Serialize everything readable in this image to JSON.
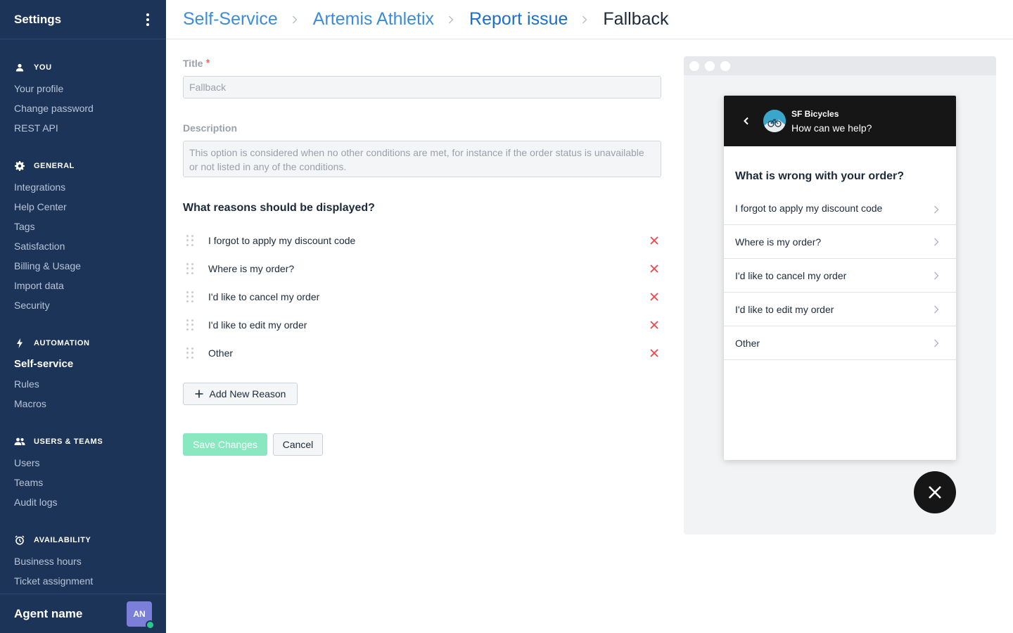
{
  "sidebar": {
    "title": "Settings",
    "sections": [
      {
        "key": "you",
        "label": "YOU",
        "icon": "user-icon",
        "items": [
          {
            "label": "Your profile"
          },
          {
            "label": "Change password"
          },
          {
            "label": "REST API"
          }
        ]
      },
      {
        "key": "general",
        "label": "GENERAL",
        "icon": "gear-icon",
        "items": [
          {
            "label": "Integrations"
          },
          {
            "label": "Help Center"
          },
          {
            "label": "Tags"
          },
          {
            "label": "Satisfaction"
          },
          {
            "label": "Billing & Usage"
          },
          {
            "label": "Import data"
          },
          {
            "label": "Security"
          }
        ]
      },
      {
        "key": "automation",
        "label": "AUTOMATION",
        "icon": "lightning-icon",
        "items": [
          {
            "label": "Self-service",
            "active": true
          },
          {
            "label": "Rules"
          },
          {
            "label": "Macros"
          }
        ]
      },
      {
        "key": "users",
        "label": "USERS & TEAMS",
        "icon": "users-icon",
        "items": [
          {
            "label": "Users"
          },
          {
            "label": "Teams"
          },
          {
            "label": "Audit logs"
          }
        ]
      },
      {
        "key": "availability",
        "label": "AVAILABILITY",
        "icon": "alarm-clock-icon",
        "items": [
          {
            "label": "Business hours"
          },
          {
            "label": "Ticket assignment"
          }
        ]
      }
    ],
    "footer": {
      "agent_name": "Agent name",
      "avatar_initials": "AN",
      "status_color": "#29c98b"
    }
  },
  "breadcrumb": [
    "Self-Service",
    "Artemis Athletix",
    "Report issue",
    "Fallback"
  ],
  "form": {
    "title_label": "Title",
    "required_mark": "*",
    "title_value": "Fallback",
    "description_label": "Description",
    "description_value": "This option is considered when no other conditions are met, for instance if the order status is unavailable or not listed in any of the conditions.",
    "reasons_heading": "What reasons should be displayed?",
    "reasons": [
      "I forgot to apply my discount code",
      "Where is my order?",
      "I'd like to cancel my order",
      "I'd like to edit my order",
      "Other"
    ],
    "add_reason_label": "Add New Reason",
    "save_label": "Save Changes",
    "cancel_label": "Cancel"
  },
  "preview": {
    "brand": "SF Bicycles",
    "subtitle": "How can we help?",
    "question": "What is wrong with your order?",
    "options": [
      "I forgot to apply my discount code",
      "Where is my order?",
      "I'd like to cancel my order",
      "I'd like to edit my order",
      "Other"
    ]
  },
  "colors": {
    "sidebar_bg": "#1c3457",
    "link": "#3e8bd9",
    "remove": "#e5484d",
    "save_button": "#8ae8c1"
  }
}
